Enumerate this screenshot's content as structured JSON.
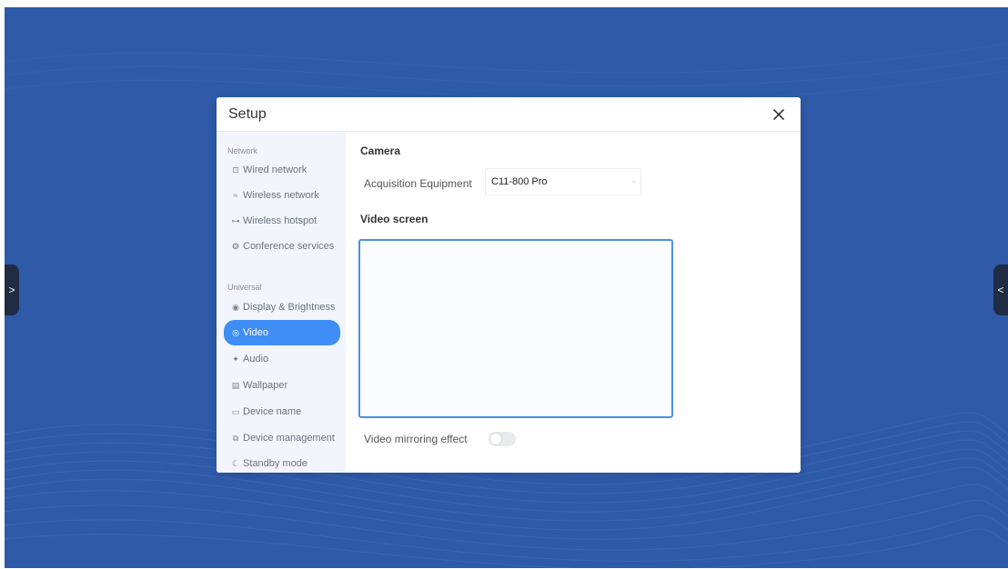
{
  "colors": {
    "desktop_background": "#2e5aa8",
    "accent": "#3f8ef5",
    "sidebar_background": "#f2f5fb",
    "video_border": "#4a90e2"
  },
  "dialog": {
    "title": "Setup",
    "close_icon": "close-icon"
  },
  "side_handles": {
    "left_glyph": ">",
    "right_glyph": "<"
  },
  "sidebar": {
    "groups": [
      {
        "label": "Network",
        "items": [
          {
            "icon": "wired-network-icon",
            "glyph": "⊡",
            "label": "Wired network"
          },
          {
            "icon": "wifi-icon",
            "glyph": "≈",
            "label": "Wireless network"
          },
          {
            "icon": "hotspot-icon",
            "glyph": "⊶",
            "label": "Wireless hotspot"
          },
          {
            "icon": "conference-services-icon",
            "glyph": "❂",
            "label": "Conference services"
          }
        ]
      },
      {
        "label": "Universal",
        "items": [
          {
            "icon": "display-brightness-icon",
            "glyph": "◉",
            "label": "Display & Brightness"
          },
          {
            "icon": "video-icon",
            "glyph": "◎",
            "label": "Video",
            "active": true
          },
          {
            "icon": "audio-icon",
            "glyph": "✦",
            "label": "Audio"
          },
          {
            "icon": "wallpaper-icon",
            "glyph": "▤",
            "label": "Wallpaper"
          },
          {
            "icon": "device-name-icon",
            "glyph": "▭",
            "label": "Device name"
          },
          {
            "icon": "device-management-icon",
            "glyph": "⧉",
            "label": "Device management"
          },
          {
            "icon": "standby-mode-icon",
            "glyph": "☾",
            "label": "Standby mode"
          }
        ]
      }
    ]
  },
  "content": {
    "camera_section": "Camera",
    "acquisition_label": "Acquisition Equipment",
    "acquisition_value": "C11-800 Pro",
    "video_screen_section": "Video screen",
    "mirroring_label": "Video mirroring effect",
    "mirroring_enabled": false
  }
}
